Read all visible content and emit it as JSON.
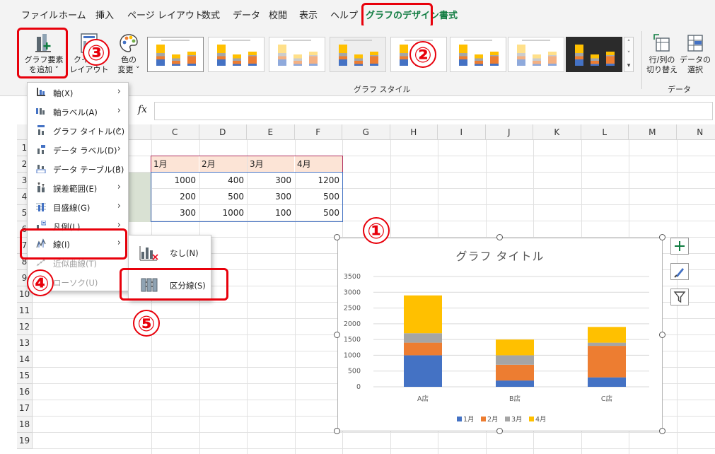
{
  "menubar": {
    "tabs": [
      "ファイル",
      "ホーム",
      "挿入",
      "ページ レイアウト",
      "数式",
      "データ",
      "校閲",
      "表示",
      "ヘルプ",
      "グラフのデザイン",
      "書式"
    ],
    "active_tab": "グラフのデザイン"
  },
  "ribbon": {
    "add_element": {
      "line1": "グラフ要素",
      "line2": "を追加"
    },
    "quick_layout": {
      "line1": "クイック",
      "line2": "レイアウト"
    },
    "change_colors": {
      "line1": "色の",
      "line2": "変更"
    },
    "chart_styles_group": "グラフ スタイル",
    "switch_row_col": {
      "line1": "行/列の",
      "line2": "切り替え"
    },
    "select_data": {
      "line1": "データの",
      "line2": "選択"
    },
    "data_group": "データ"
  },
  "formula_bar": {
    "fx": "fx"
  },
  "columns": [
    "C",
    "D",
    "E",
    "F",
    "G",
    "H",
    "I",
    "J",
    "K",
    "L",
    "M",
    "N"
  ],
  "rows": [
    "1",
    "2",
    "3",
    "4",
    "5",
    "6",
    "7",
    "8",
    "9",
    "10",
    "11",
    "12",
    "13",
    "14",
    "15",
    "16",
    "17",
    "18",
    "19"
  ],
  "table": {
    "headers": [
      "1月",
      "2月",
      "3月",
      "4月"
    ],
    "rows": [
      [
        "1000",
        "400",
        "300",
        "1200"
      ],
      [
        "200",
        "500",
        "300",
        "500"
      ],
      [
        "300",
        "1000",
        "100",
        "500"
      ]
    ]
  },
  "dropdown_menu": {
    "items": [
      {
        "label": "軸(X)",
        "icon": "axis-icon",
        "enabled": true
      },
      {
        "label": "軸ラベル(A)",
        "icon": "axis-label-icon",
        "enabled": true
      },
      {
        "label": "グラフ タイトル(C)",
        "icon": "chart-title-icon",
        "enabled": true
      },
      {
        "label": "データ ラベル(D)",
        "icon": "data-label-icon",
        "enabled": true
      },
      {
        "label": "データ テーブル(B)",
        "icon": "data-table-icon",
        "enabled": true
      },
      {
        "label": "誤差範囲(E)",
        "icon": "error-bars-icon",
        "enabled": true
      },
      {
        "label": "目盛線(G)",
        "icon": "gridlines-icon",
        "enabled": true
      },
      {
        "label": "凡例(L)",
        "icon": "legend-icon",
        "enabled": true
      },
      {
        "label": "線(I)",
        "icon": "lines-icon",
        "enabled": true
      },
      {
        "label": "近似曲線(T)",
        "icon": "trendline-icon",
        "enabled": false
      },
      {
        "label": "ローソク(U)",
        "icon": "up-down-bars-icon",
        "enabled": false
      }
    ]
  },
  "submenu": {
    "items": [
      {
        "label": "なし(N)",
        "icon": "no-lines-icon"
      },
      {
        "label": "区分線(S)",
        "icon": "series-lines-icon"
      }
    ]
  },
  "callouts": [
    "①",
    "②",
    "③",
    "④",
    "⑤"
  ],
  "colors": {
    "jan": "#4472c4",
    "feb": "#ed7d31",
    "mar": "#a5a5a5",
    "apr": "#ffc000",
    "accent": "#107c41",
    "callout": "#e8000b"
  },
  "chart_data": {
    "type": "bar",
    "stacked": true,
    "title": "グラフ タイトル",
    "categories": [
      "A店",
      "B店",
      "C店"
    ],
    "series": [
      {
        "name": "1月",
        "values": [
          1000,
          200,
          300
        ]
      },
      {
        "name": "2月",
        "values": [
          400,
          500,
          1000
        ]
      },
      {
        "name": "3月",
        "values": [
          300,
          300,
          100
        ]
      },
      {
        "name": "4月",
        "values": [
          1200,
          500,
          500
        ]
      }
    ],
    "ylim": [
      0,
      3500
    ],
    "yticks": [
      "0",
      "500",
      "1000",
      "1500",
      "2000",
      "2500",
      "3000",
      "3500"
    ],
    "legend": "bottom",
    "grid": true
  }
}
